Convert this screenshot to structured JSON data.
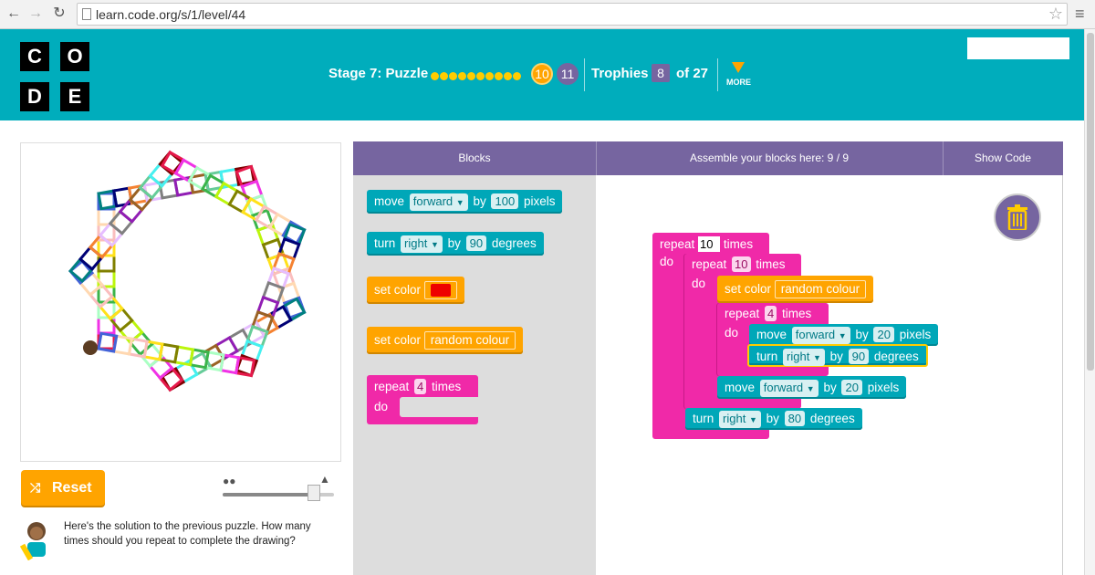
{
  "browser": {
    "url": "learn.code.org/s/1/level/44"
  },
  "logo": {
    "letters": [
      "C",
      "O",
      "D",
      "E"
    ]
  },
  "header": {
    "stage_label": "Stage 7: Puzzle",
    "current_level": "10",
    "next_level": "11",
    "trophies_label": "Trophies",
    "trophies_count": "8",
    "trophies_total": "of 27",
    "more_label": "MORE",
    "colors": {
      "bar": "#00adbc",
      "accent": "#ffa400",
      "purple": "#7665a0"
    }
  },
  "play": {
    "reset_label": "Reset",
    "instructions": "Here's the solution to the previous puzzle. How many times should you repeat to complete the drawing?"
  },
  "workspace_header": {
    "blocks_label": "Blocks",
    "assemble_label": "Assemble your blocks here: 9 / 9",
    "show_code_label": "Show Code"
  },
  "toolbox": {
    "move_word": "move",
    "move_dir": "forward",
    "move_by": "by",
    "move_value": "100",
    "move_unit": "pixels",
    "turn_word": "turn",
    "turn_dir": "right",
    "turn_by": "by",
    "turn_value": "90",
    "turn_unit": "degrees",
    "setcolor1_label": "set color",
    "setcolor2_label": "set color",
    "setcolor2_value": "random colour",
    "repeat_word": "repeat",
    "repeat_value": "4",
    "repeat_unit": "times",
    "repeat_do": "do"
  },
  "program": {
    "outer_repeat_word": "repeat",
    "outer_repeat_value": "10",
    "outer_repeat_unit": "times",
    "outer_do": "do",
    "inner_repeat_word": "repeat",
    "inner_repeat_value": "10",
    "inner_repeat_unit": "times",
    "inner_do": "do",
    "setcolor_label": "set color",
    "setcolor_value": "random colour",
    "sq_repeat_word": "repeat",
    "sq_repeat_value": "4",
    "sq_repeat_unit": "times",
    "sq_do": "do",
    "sq_move_word": "move",
    "sq_move_dir": "forward",
    "sq_move_by": "by",
    "sq_move_value": "20",
    "sq_move_unit": "pixels",
    "sq_turn_word": "turn",
    "sq_turn_dir": "right",
    "sq_turn_by": "by",
    "sq_turn_value": "90",
    "sq_turn_unit": "degrees",
    "move2_word": "move",
    "move2_dir": "forward",
    "move2_by": "by",
    "move2_value": "20",
    "move2_unit": "pixels",
    "turn2_word": "turn",
    "turn2_dir": "right",
    "turn2_by": "by",
    "turn2_value": "80",
    "turn2_unit": "degrees"
  },
  "icons": {
    "back": "back-arrow-icon",
    "forward": "forward-arrow-icon",
    "reload": "reload-icon",
    "shuffle": "shuffle-icon",
    "turtle": "turtle-icon",
    "rabbit": "rabbit-icon",
    "trash": "trash-icon"
  }
}
